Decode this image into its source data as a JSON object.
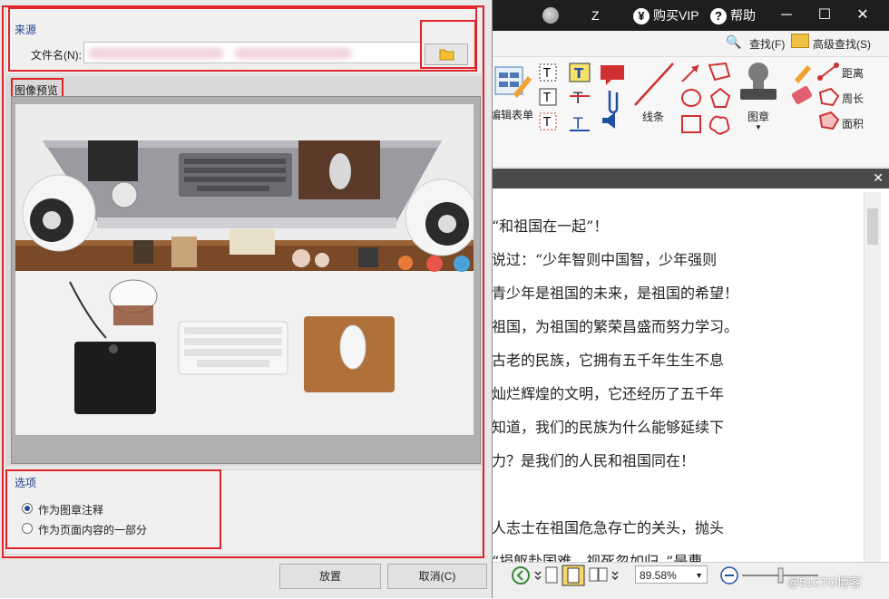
{
  "titlebar": {
    "z_label": "Z",
    "vip_label": "购买VIP",
    "vip_icon": "¥",
    "help_label": "帮助",
    "help_icon": "?",
    "minimize": "─",
    "maximize": "☐",
    "close": "✕"
  },
  "ribbon": {
    "find_label": "查找(F)",
    "advanced_find_label": "高级查找(S)",
    "edit_form_label": "编辑表单",
    "line_label": "线条",
    "stamp_label": "图章",
    "distance_label": "距离",
    "perimeter_label": "周长",
    "area_label": "面积"
  },
  "document": {
    "close_icon": "✕",
    "lines": [
      "“和祖国在一起”！",
      "说过：“少年智则中国智，少年强则",
      "青少年是祖国的未来，是祖国的希望！",
      "祖国，为祖国的繁荣昌盛而努力学习。",
      "古老的民族，它拥有五千年生生不息",
      "灿烂辉煌的文明，它还经历了五千年",
      "知道，我们的民族为什么能够延续下",
      "力？是我们的人民和祖国同在！",
      "",
      "人志士在祖国危急存亡的关头，抛头",
      "“捐躯赴国难，视死忽如归。”是曹"
    ]
  },
  "statusbar": {
    "zoom_value": "89.58%",
    "watermark": "@51CTO博客"
  },
  "dialog": {
    "source_group_title": "来源",
    "filename_label": "文件名(N):",
    "filename_value": "",
    "preview_group_title": "图像预览",
    "options_group_title": "选项",
    "options": [
      {
        "label": "作为图章注释",
        "selected": true
      },
      {
        "label": "作为页面内容的一部分",
        "selected": false
      }
    ],
    "place_button": "放置",
    "cancel_button": "取消(C)"
  },
  "colors": {
    "highlight": "#e0242a",
    "group_title": "#1c3f8c",
    "titlebar": "#1e1e1e"
  }
}
